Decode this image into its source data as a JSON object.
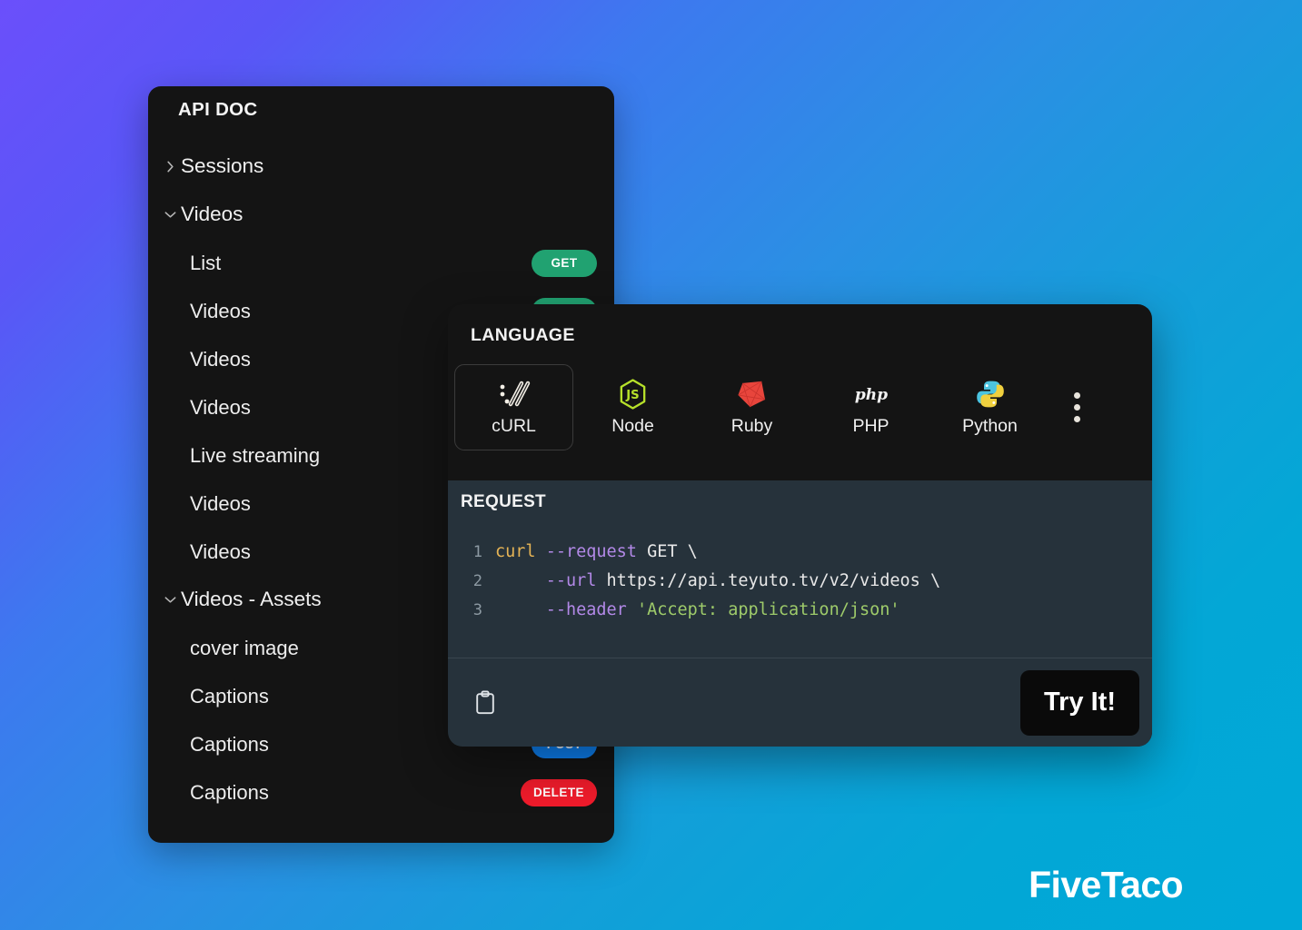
{
  "sidebar": {
    "title": "API DOC",
    "items": [
      {
        "label": "Sessions",
        "type": "group",
        "caret": "chevron-right-icon",
        "method": null
      },
      {
        "label": "Videos",
        "type": "group",
        "caret": "chevron-down-icon",
        "method": null
      },
      {
        "label": "List",
        "type": "child",
        "caret": null,
        "method": "GET"
      },
      {
        "label": "Videos",
        "type": "child",
        "caret": null,
        "method": "GET"
      },
      {
        "label": "Videos",
        "type": "child",
        "caret": null,
        "method": null
      },
      {
        "label": "Videos",
        "type": "child",
        "caret": null,
        "method": null
      },
      {
        "label": "Live streaming",
        "type": "child",
        "caret": null,
        "method": null
      },
      {
        "label": "Videos",
        "type": "child",
        "caret": null,
        "method": null
      },
      {
        "label": "Videos",
        "type": "child",
        "caret": null,
        "method": null
      },
      {
        "label": "Videos - Assets",
        "type": "group",
        "caret": "chevron-down-icon",
        "method": null
      },
      {
        "label": "cover image",
        "type": "child",
        "caret": null,
        "method": null
      },
      {
        "label": "Captions",
        "type": "child",
        "caret": null,
        "method": null
      },
      {
        "label": "Captions",
        "type": "child",
        "caret": null,
        "method": "POST"
      },
      {
        "label": "Captions",
        "type": "child",
        "caret": null,
        "method": "DELETE"
      }
    ]
  },
  "code_panel": {
    "language_label": "LANGUAGE",
    "languages": [
      {
        "name": "cURL",
        "icon": "curl-icon",
        "selected": true
      },
      {
        "name": "Node",
        "icon": "node-icon",
        "selected": false
      },
      {
        "name": "Ruby",
        "icon": "ruby-icon",
        "selected": false
      },
      {
        "name": "PHP",
        "icon": "php-icon",
        "selected": false
      },
      {
        "name": "Python",
        "icon": "python-icon",
        "selected": false
      }
    ],
    "more_icon": "kebab-menu-icon",
    "request_label": "REQUEST",
    "code_lines": [
      {
        "number": "1",
        "text": "curl --request GET \\"
      },
      {
        "number": "2",
        "text": "     --url https://api.teyuto.tv/v2/videos \\"
      },
      {
        "number": "3",
        "text": "     --header 'Accept: application/json'"
      }
    ],
    "code_tokens": [
      [
        {
          "t": "curl",
          "c": "cmd"
        },
        {
          "t": " ",
          "c": "plain"
        },
        {
          "t": "--request",
          "c": "flag"
        },
        {
          "t": " GET \\",
          "c": "plain"
        }
      ],
      [
        {
          "t": "     ",
          "c": "plain"
        },
        {
          "t": "--url",
          "c": "flag"
        },
        {
          "t": " https://api.teyuto.tv/v2/videos \\",
          "c": "plain"
        }
      ],
      [
        {
          "t": "     ",
          "c": "plain"
        },
        {
          "t": "--header",
          "c": "flag"
        },
        {
          "t": " ",
          "c": "plain"
        },
        {
          "t": "'Accept: application/json'",
          "c": "str"
        }
      ]
    ],
    "copy_icon": "clipboard-copy-icon",
    "try_it_label": "Try It!"
  },
  "brand": {
    "name": "FiveTaco"
  },
  "colors": {
    "method_get": "#21a271",
    "method_post": "#0d80f2",
    "method_delete": "#ef1b2b",
    "panel_bg": "#141414",
    "code_bg": "#26323b",
    "gradient_start": "#6b4ffb",
    "gradient_end": "#00a8d8",
    "token_command": "#e6b455",
    "token_flag": "#b389e8",
    "token_string": "#9ecb6a"
  }
}
